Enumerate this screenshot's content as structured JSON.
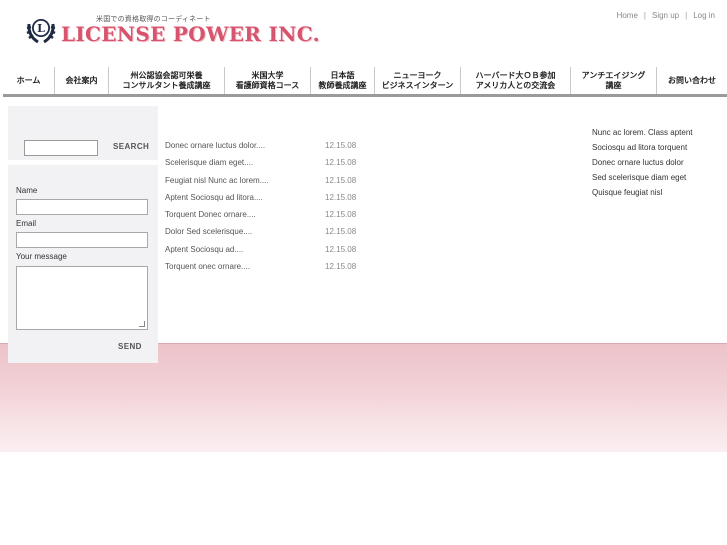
{
  "header": {
    "tagline": "米国での資格取得のコーディネート",
    "brand": "LICENSE POWER INC.",
    "emblem_letter": "L"
  },
  "toplinks": [
    {
      "label": "Home"
    },
    {
      "label": "Sign up"
    },
    {
      "label": "Log in"
    }
  ],
  "toplink_separator": "|",
  "nav": [
    {
      "line1": "ホーム",
      "line2": "",
      "width": 52
    },
    {
      "line1": "会社案内",
      "line2": "",
      "width": 54
    },
    {
      "line1": "州公認協会認可栄養",
      "line2": "コンサルタント養成講座",
      "width": 116
    },
    {
      "line1": "米国大学",
      "line2": "看護師資格コース",
      "width": 86
    },
    {
      "line1": "日本語",
      "line2": "教師養成講座",
      "width": 64
    },
    {
      "line1": "ニューヨーク",
      "line2": "ビジネスインターン",
      "width": 86
    },
    {
      "line1": "ハーバード大ＯＢ参加",
      "line2": "アメリカ人との交流会",
      "width": 110
    },
    {
      "line1": "アンチエイジング",
      "line2": "講座",
      "width": 86
    },
    {
      "line1": "お問い合わせ",
      "line2": "",
      "width": 70
    }
  ],
  "search": {
    "value": "",
    "button": "SEARCH"
  },
  "contact": {
    "name_label": "Name",
    "email_label": "Email",
    "message_label": "Your message",
    "send_button": "SEND"
  },
  "articles": [
    {
      "title": "Donec ornare luctus dolor....",
      "date": "12.15.08"
    },
    {
      "title": "Scelerisque diam eget....",
      "date": "12.15.08"
    },
    {
      "title": "Feugiat nisl Nunc ac lorem....",
      "date": "12.15.08"
    },
    {
      "title": "Aptent Sociosqu ad litora....",
      "date": "12.15.08"
    },
    {
      "title": "Torquent Donec ornare....",
      "date": "12.15.08"
    },
    {
      "title": "Dolor Sed scelerisque....",
      "date": "12.15.08"
    },
    {
      "title": "Aptent Sociosqu ad....",
      "date": "12.15.08"
    },
    {
      "title": "Torquent onec ornare....",
      "date": "12.15.08"
    }
  ],
  "right_links": [
    {
      "label": "Nunc ac lorem. Class aptent"
    },
    {
      "label": "Sociosqu ad litora torquent"
    },
    {
      "label": "Donec ornare luctus dolor"
    },
    {
      "label": "Sed scelerisque diam eget"
    },
    {
      "label": "Quisque feugiat nisl"
    }
  ],
  "colors": {
    "brand": "#d7546e",
    "band_top": "#ecc3c9",
    "panel_bg": "#f2f1f3"
  }
}
